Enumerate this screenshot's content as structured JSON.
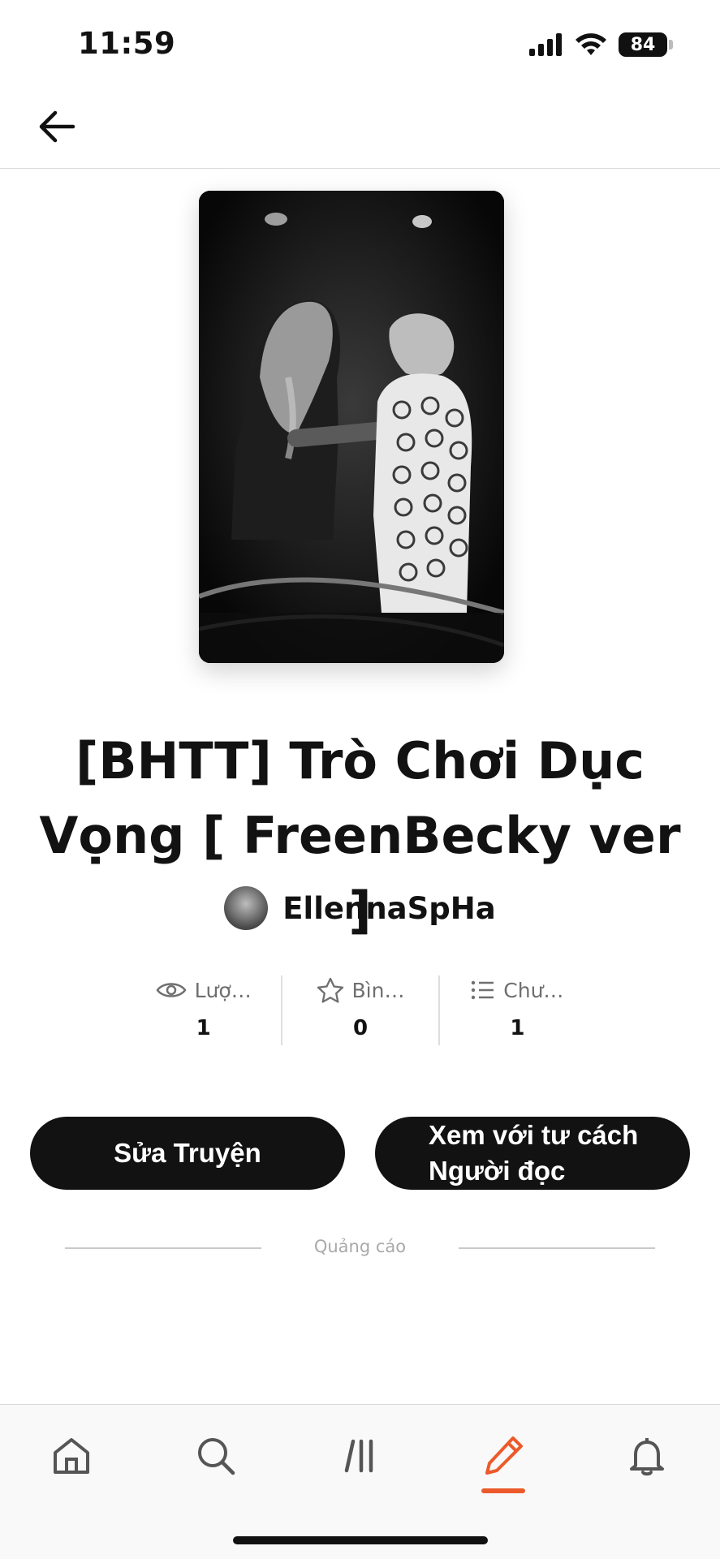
{
  "status_bar": {
    "time": "11:59",
    "battery": "84"
  },
  "story": {
    "title": "[BHTT] Trò Chơi Dục Vọng [ FreenBecky ver ]",
    "author": "EllennaSpHa"
  },
  "stats": [
    {
      "icon": "eye-icon",
      "label": "Lượ…",
      "value": "1"
    },
    {
      "icon": "star-icon",
      "label": "Bìn…",
      "value": "0"
    },
    {
      "icon": "list-icon",
      "label": "Chư…",
      "value": "1"
    }
  ],
  "actions": {
    "edit_label": "Sửa Truyện",
    "read_line1": "Xem với tư cách",
    "read_line2": "Người đọc"
  },
  "ad": {
    "label": "Quảng cáo"
  },
  "bottom_nav": {
    "items": [
      "home-icon",
      "search-icon",
      "library-icon",
      "write-icon",
      "bell-icon"
    ],
    "active": "write-icon",
    "accent": "#ec5a2b"
  }
}
